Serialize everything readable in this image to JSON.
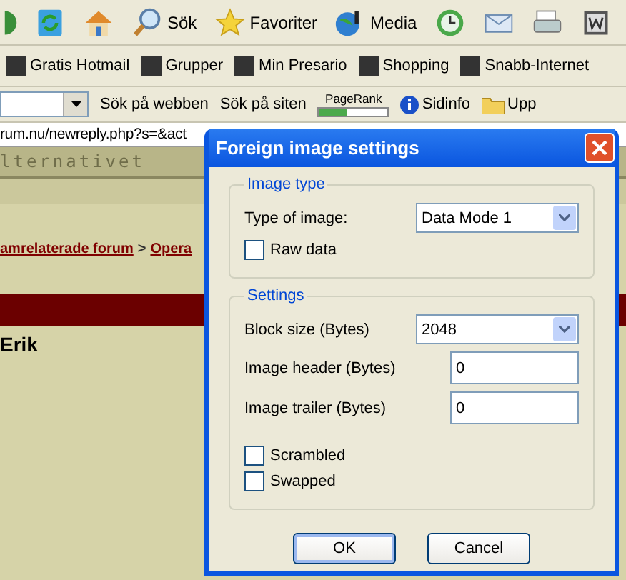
{
  "toolbar": {
    "buttons": [
      {
        "kind": "back"
      },
      {
        "kind": "refresh"
      },
      {
        "kind": "home"
      },
      {
        "kind": "search",
        "label": "Sök"
      },
      {
        "kind": "favorites",
        "label": "Favoriter"
      },
      {
        "kind": "media",
        "label": "Media"
      },
      {
        "kind": "history"
      },
      {
        "kind": "mail"
      },
      {
        "kind": "print"
      },
      {
        "kind": "word"
      }
    ]
  },
  "links_bar": {
    "items": [
      {
        "label": "Gratis Hotmail"
      },
      {
        "label": "Grupper"
      },
      {
        "label": "Min Presario"
      },
      {
        "label": "Shopping"
      },
      {
        "label": "Snabb-Internet"
      }
    ]
  },
  "search_bar": {
    "search_web": "Sök på webben",
    "search_site": "Sök på siten",
    "pagerank": {
      "label": "PageRank",
      "level": 0.4
    },
    "page_info": "Sidinfo",
    "up": "Upp"
  },
  "address": {
    "value": "rum.nu/newreply.php?s=&act"
  },
  "page": {
    "logo": "lternativet",
    "breadcrumb": [
      {
        "label": "amrelaterade forum"
      },
      {
        "label": ">"
      },
      {
        "label": "Opera"
      }
    ],
    "author": "Erik"
  },
  "dialog": {
    "title": "Foreign image settings",
    "image_type": {
      "legend": "Image type",
      "type_label": "Type of image:",
      "type_value": "Data Mode 1",
      "raw_data": {
        "label": "Raw data",
        "checked": false
      }
    },
    "settings": {
      "legend": "Settings",
      "fields": [
        {
          "kind": "select",
          "label": "Block size (Bytes)",
          "value": "2048"
        },
        {
          "kind": "input",
          "label": "Image header (Bytes)",
          "value": "0"
        },
        {
          "kind": "input",
          "label": "Image trailer (Bytes)",
          "value": "0"
        }
      ],
      "checks": [
        {
          "label": "Scrambled",
          "checked": false
        },
        {
          "label": "Swapped",
          "checked": false
        }
      ]
    },
    "buttons": [
      {
        "label": "OK",
        "default": true
      },
      {
        "label": "Cancel",
        "default": false
      }
    ]
  }
}
